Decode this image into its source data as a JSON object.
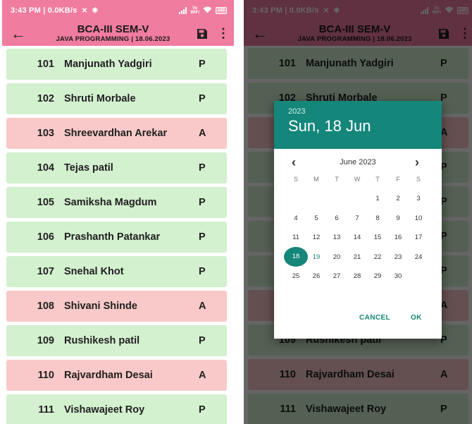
{
  "status_bar": {
    "time_speed": "3:43 PM | 0.0KB/s",
    "volte_top": "Vo",
    "volte_bottom": "WiFi",
    "battery": "100"
  },
  "toolbar": {
    "title": "BCA-III  SEM-V",
    "subtitle": "JAVA PROGRAMMING  | 18.06.2023",
    "back_icon": "arrow-back-icon",
    "save_icon": "save-icon",
    "more_icon": "more-vert-icon"
  },
  "colors": {
    "appbar": "#f07ca0",
    "present_row": "#d3f0cf",
    "absent_row": "#f9c9c9",
    "dialog_accent": "#14867a"
  },
  "students": [
    {
      "roll": "101",
      "name": "Manjunath Yadgiri",
      "status": "P"
    },
    {
      "roll": "102",
      "name": "Shruti Morbale",
      "status": "P"
    },
    {
      "roll": "103",
      "name": "Shreevardhan Arekar",
      "status": "A"
    },
    {
      "roll": "104",
      "name": "Tejas patil",
      "status": "P"
    },
    {
      "roll": "105",
      "name": "Samiksha Magdum",
      "status": "P"
    },
    {
      "roll": "106",
      "name": "Prashanth Patankar",
      "status": "P"
    },
    {
      "roll": "107",
      "name": "Snehal Khot",
      "status": "P"
    },
    {
      "roll": "108",
      "name": "Shivani Shinde",
      "status": "A"
    },
    {
      "roll": "109",
      "name": "Rushikesh patil",
      "status": "P"
    },
    {
      "roll": "110",
      "name": "Rajvardham Desai",
      "status": "A"
    },
    {
      "roll": "111",
      "name": "Vishawajeet Roy",
      "status": "P"
    }
  ],
  "date_picker": {
    "year": "2023",
    "selected_label": "Sun, 18 Jun",
    "month_label": "June 2023",
    "weekdays": [
      "S",
      "M",
      "T",
      "W",
      "T",
      "F",
      "S"
    ],
    "days": [
      "1",
      "2",
      "3",
      "4",
      "5",
      "6",
      "7",
      "8",
      "9",
      "10",
      "11",
      "12",
      "13",
      "14",
      "15",
      "16",
      "17",
      "18",
      "19",
      "20",
      "21",
      "22",
      "23",
      "24",
      "25",
      "26",
      "27",
      "28",
      "29",
      "30"
    ],
    "first_weekday_index": 4,
    "selected_day": "18",
    "today_day": "19",
    "cancel_label": "CANCEL",
    "ok_label": "OK"
  }
}
